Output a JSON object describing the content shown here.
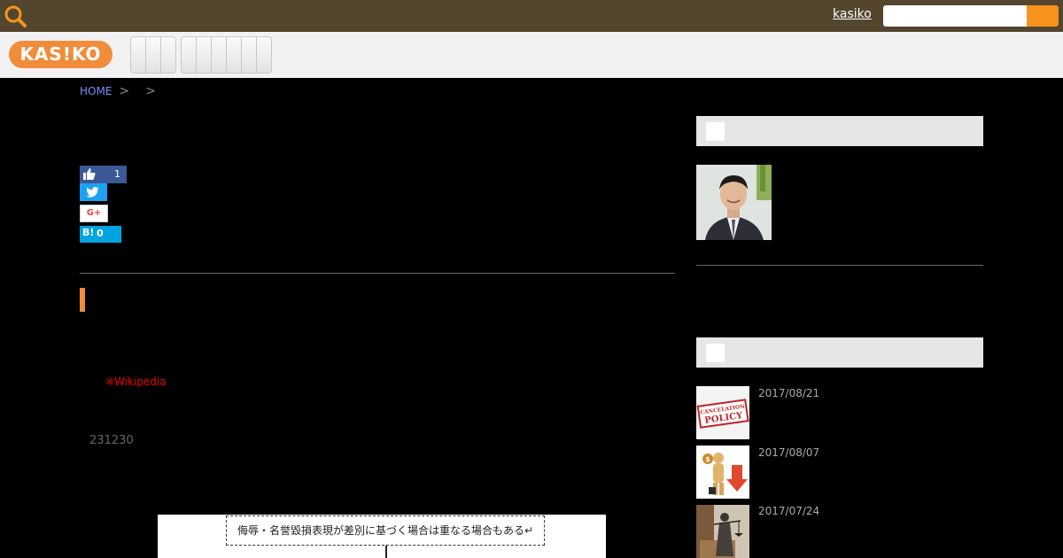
{
  "topbar": {
    "user_link": "kasiko",
    "search_placeholder": ""
  },
  "nav": {
    "logo_text": "KAS!KO"
  },
  "breadcrumb": {
    "home": "HOME",
    "sep1": ">",
    "sep2": ">"
  },
  "share": {
    "facebook_count": "1",
    "hatena_label": "B!",
    "hatena_count": "0",
    "google_label": "G+"
  },
  "article": {
    "source_note": "※Wikipedia",
    "number_text": "231230",
    "diagram_text": "侮辱・名誉毀損表現が差別に基づく場合は重なる場合もある↵"
  },
  "sidebar": {
    "recent_posts": [
      {
        "date": "2017/08/21",
        "thumb_text_1": "CANCELATION",
        "thumb_text_2": "POLICY"
      },
      {
        "date": "2017/08/07"
      },
      {
        "date": "2017/07/24"
      }
    ]
  },
  "colors": {
    "accent": "#f08c3a",
    "topbar": "#54452f",
    "search_button": "#f7941d"
  }
}
